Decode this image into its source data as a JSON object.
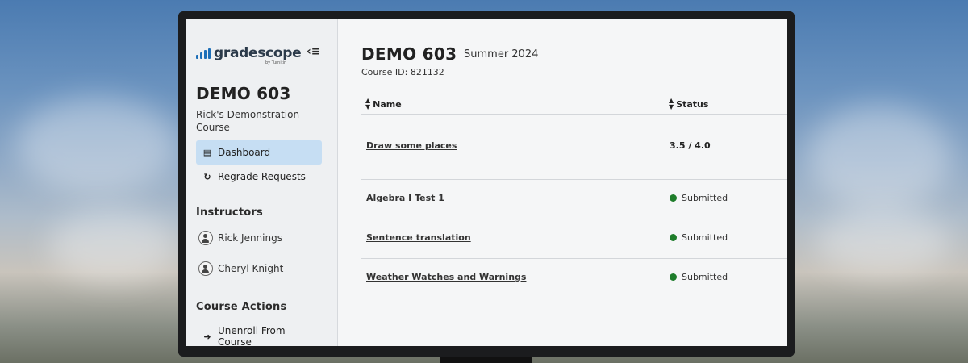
{
  "sidebar": {
    "logo_text": "gradescope",
    "logo_sub": "by Turnitin",
    "collapse_icon": "collapse-sidebar-icon",
    "course_title": "DEMO 603",
    "course_desc": "Rick's Demonstration Course",
    "nav": [
      {
        "label": "Dashboard",
        "icon": "dashboard-icon",
        "active": true
      },
      {
        "label": "Regrade Requests",
        "icon": "refresh-icon",
        "active": false
      }
    ],
    "instructors_heading": "Instructors",
    "instructors": [
      "Rick Jennings",
      "Cheryl Knight"
    ],
    "actions_heading": "Course Actions",
    "actions": [
      {
        "label": "Unenroll From Course",
        "icon": "sign-out-icon"
      }
    ]
  },
  "main": {
    "title": "DEMO 603",
    "term": "Summer 2024",
    "course_id": "Course ID: 821132",
    "columns": [
      "Name",
      "Status"
    ],
    "rows": [
      {
        "name": "Draw some places",
        "status": "3.5 / 4.0",
        "type": "score"
      },
      {
        "name": "Algebra I Test 1",
        "status": "Submitted",
        "type": "submitted"
      },
      {
        "name": "Sentence translation",
        "status": "Submitted",
        "type": "submitted"
      },
      {
        "name": "Weather Watches and Warnings",
        "status": "Submitted",
        "type": "submitted"
      }
    ]
  },
  "colors": {
    "accent": "#1d6fb8",
    "active_nav": "#c6def3",
    "submitted": "#1e7d2b"
  }
}
